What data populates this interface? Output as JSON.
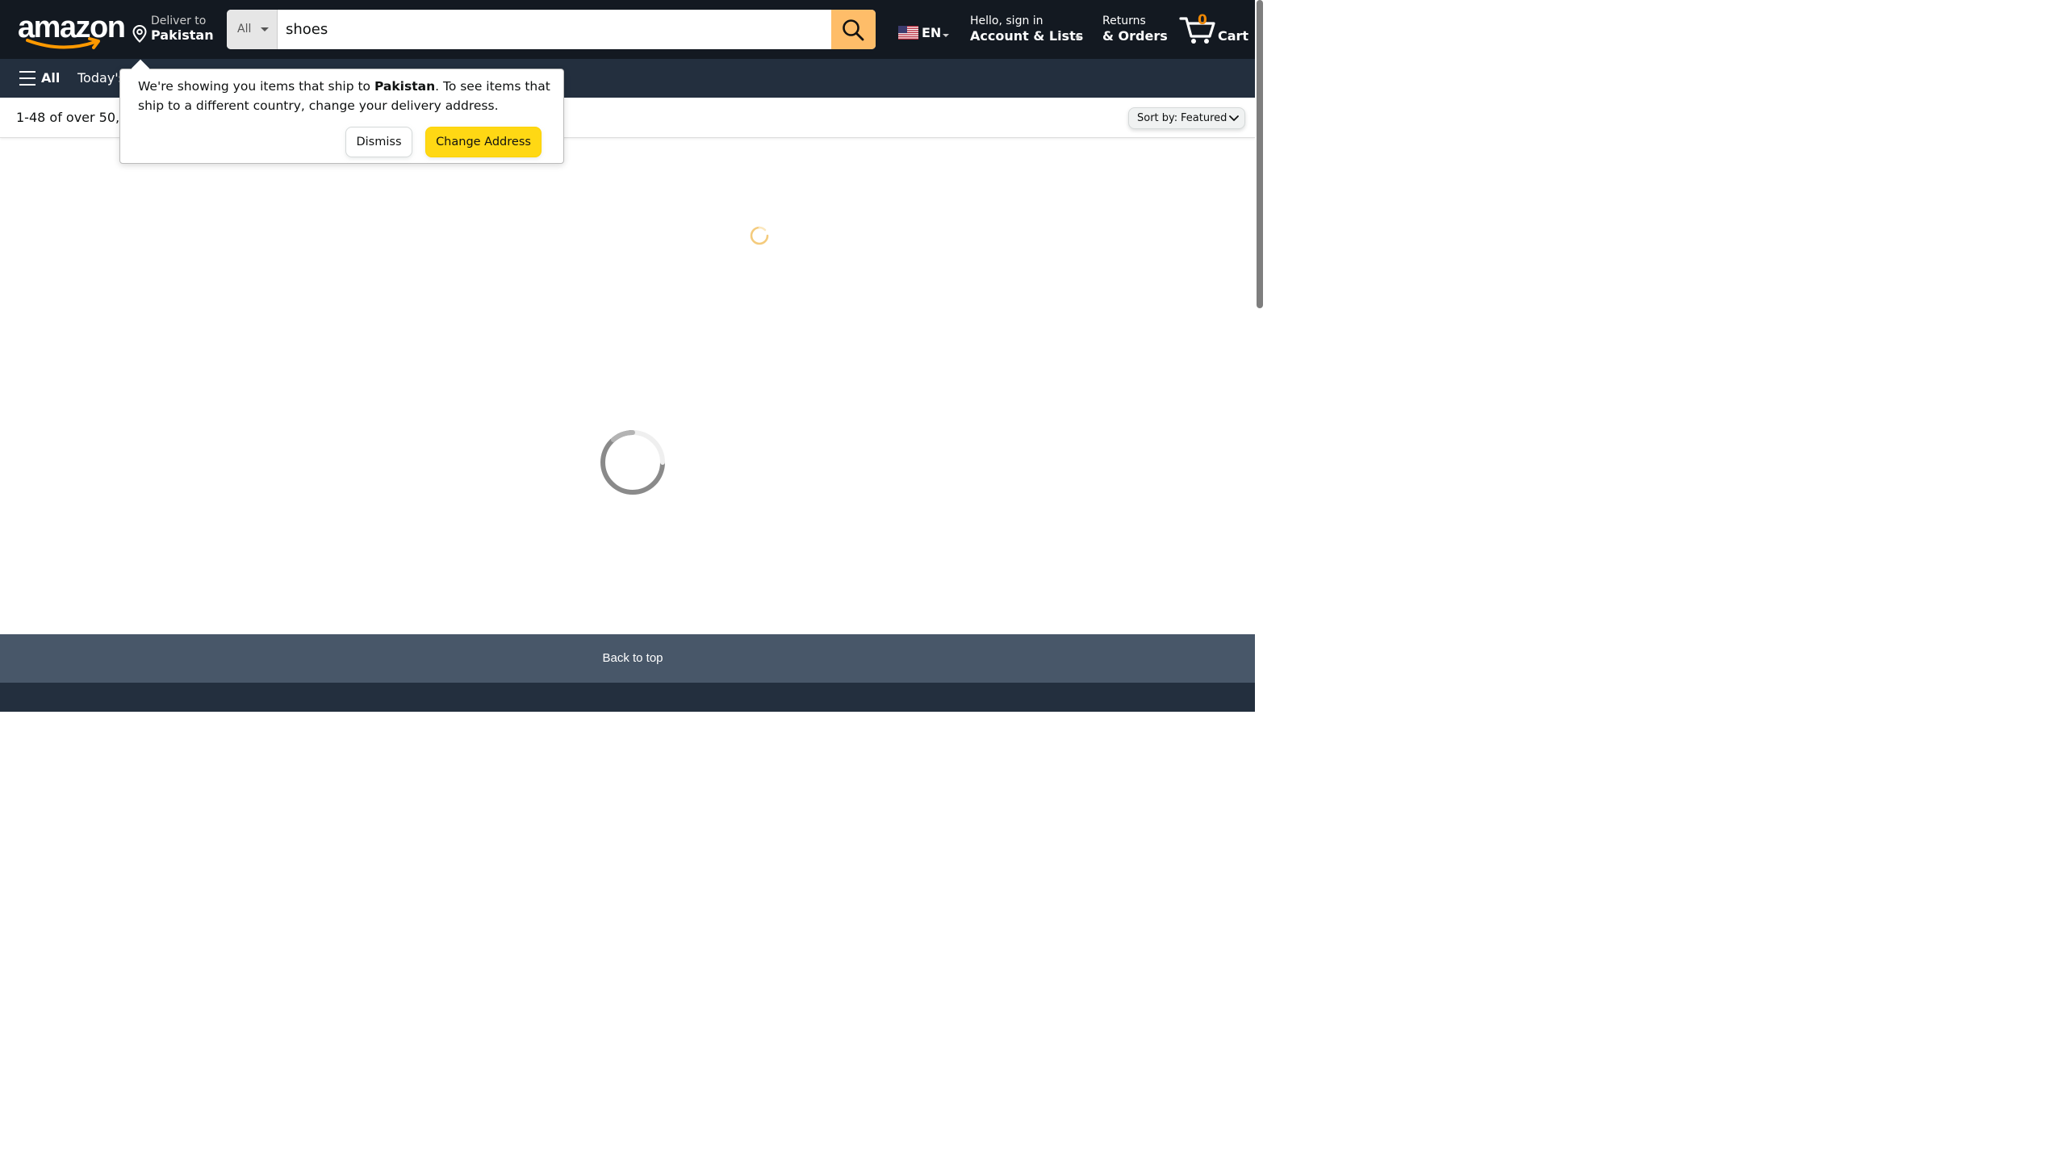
{
  "header": {
    "logo_text": "amazon",
    "deliver": {
      "line1": "Deliver to",
      "line2": "Pakistan"
    },
    "search": {
      "category": "All",
      "query": "shoes"
    },
    "language": {
      "code": "EN"
    },
    "account": {
      "line1": "Hello, sign in",
      "line2": "Account & Lists"
    },
    "orders": {
      "line1": "Returns",
      "line2": "& Orders"
    },
    "cart": {
      "count": "0",
      "label": "Cart"
    }
  },
  "nav": {
    "all_label": "All",
    "today_label": "Today's"
  },
  "results": {
    "count_text": "1-48 of over 50,0",
    "sort_label": "Sort by:",
    "sort_value": "Featured"
  },
  "popover": {
    "msg_before": "We're showing you items that ship to ",
    "msg_country": "Pakistan",
    "msg_after": ". To see items that ship to a different country, change your delivery address.",
    "dismiss_label": "Dismiss",
    "change_label": "Change Address"
  },
  "footer": {
    "back_to_top": "Back to top"
  },
  "colors": {
    "nav_dark": "#131921",
    "nav_secondary": "#232f3e",
    "search_button": "#febd69",
    "primary_button": "#ffd814",
    "cart_count": "#f08804",
    "back_to_top_bg": "#485769"
  },
  "icons": [
    "location-pin-icon",
    "search-icon",
    "us-flag-icon",
    "cart-icon",
    "hamburger-icon",
    "chevron-down-icon",
    "loading-spinner-icon"
  ]
}
